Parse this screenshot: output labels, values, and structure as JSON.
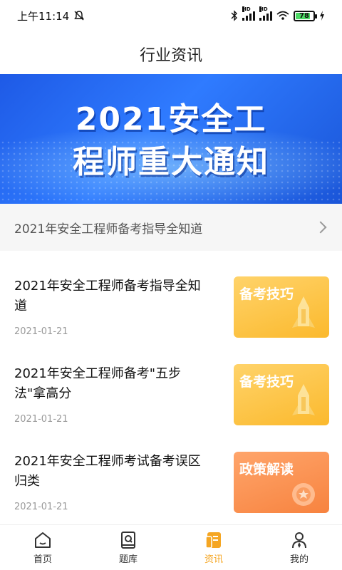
{
  "status_bar": {
    "time": "上午11:14",
    "battery": "78",
    "signal_labels": [
      "HD",
      "HD"
    ]
  },
  "header": {
    "title": "行业资讯"
  },
  "banner": {
    "line1": "2021安全工",
    "line2": "程师重大通知"
  },
  "notice": {
    "text": "2021年安全工程师备考指导全知道"
  },
  "articles": [
    {
      "title": "2021年安全工程师备考指导全知道",
      "date": "2021-01-21",
      "tag": "备考技巧",
      "thumb_color": "yellow"
    },
    {
      "title": "2021年安全工程师备考\"五步法\"拿高分",
      "date": "2021-01-21",
      "tag": "备考技巧",
      "thumb_color": "yellow"
    },
    {
      "title": "2021年安全工程师考试备考误区归类",
      "date": "2021-01-21",
      "tag": "政策解读",
      "thumb_color": "orange"
    }
  ],
  "tabbar": {
    "items": [
      {
        "label": "首页",
        "icon": "home-icon",
        "active": false
      },
      {
        "label": "题库",
        "icon": "question-bank-icon",
        "active": false
      },
      {
        "label": "资讯",
        "icon": "news-icon",
        "active": true
      },
      {
        "label": "我的",
        "icon": "profile-icon",
        "active": false
      }
    ]
  },
  "colors": {
    "accent": "#f5a623",
    "banner_blue": "#2f7bff"
  }
}
